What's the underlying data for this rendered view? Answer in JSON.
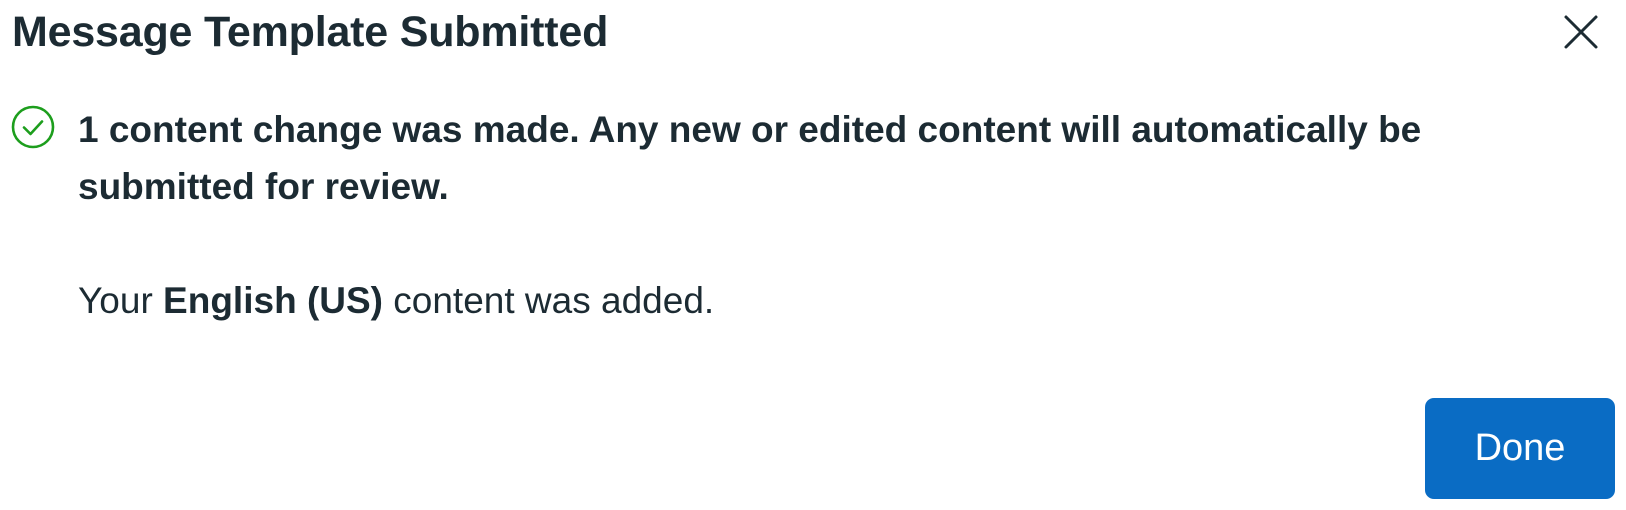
{
  "dialog": {
    "title": "Message Template Submitted",
    "close_icon": "close-icon",
    "status_icon": "check-circle-icon",
    "status_color": "#1d9e1d",
    "heading": "1 content change was made. Any new or edited content will automatically be submitted for review.",
    "body": {
      "prefix": "Your ",
      "language": "English (US)",
      "suffix": " content was added."
    },
    "done_label": "Done",
    "primary_color": "#0a6cc4"
  }
}
